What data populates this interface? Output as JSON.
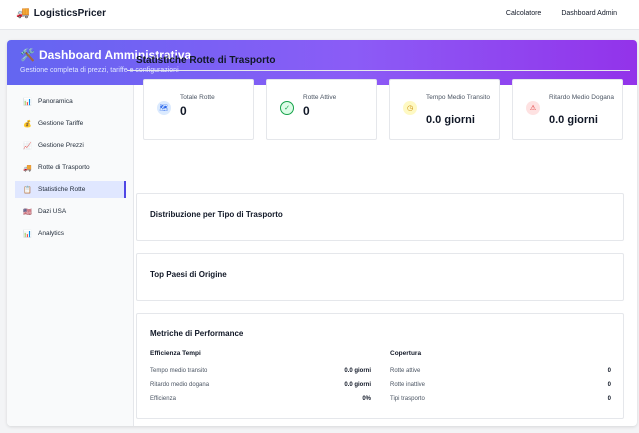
{
  "header": {
    "brand_icon": "🚚",
    "brand": "LogisticsPricer",
    "nav": [
      "Calcolatore",
      "Dashboard Admin"
    ]
  },
  "hero": {
    "icon": "🛠️",
    "title": "Dashboard Amministrativa",
    "subtitle": "Gestione completa di prezzi, tariffe e configurazioni",
    "gradient": [
      "#6366f1",
      "#9333ea"
    ]
  },
  "sidebar": {
    "items": [
      {
        "icon": "📊",
        "label": "Panoramica"
      },
      {
        "icon": "💰",
        "label": "Gestione Tariffe"
      },
      {
        "icon": "📈",
        "label": "Gestione Prezzi"
      },
      {
        "icon": "🚚",
        "label": "Rotte di Trasporto"
      },
      {
        "icon": "📋",
        "label": "Statistiche Rotte",
        "active": true
      },
      {
        "icon": "🇺🇸",
        "label": "Dazi USA"
      },
      {
        "icon": "📊",
        "label": "Analytics"
      }
    ]
  },
  "main": {
    "title": "Statistiche Rotte di Trasporto",
    "stats": [
      {
        "icon": "map-icon",
        "glyph": "🗺",
        "label": "Totale Rotte",
        "value": "0",
        "color": "#dbeafe"
      },
      {
        "icon": "check-circle-icon",
        "glyph": "✓",
        "label": "Rotte Attive",
        "value": "0",
        "color": "#dcfce7"
      },
      {
        "icon": "clock-icon",
        "glyph": "◷",
        "label": "Tempo Medio Transito",
        "value": "0.0 giorni",
        "color": "#fef9c3"
      },
      {
        "icon": "warning-icon",
        "glyph": "⚠",
        "label": "Ritardo Medio Dogana",
        "value": "0.0 giorni",
        "color": "#fee2e2"
      }
    ],
    "distribution_title": "Distribuzione per Tipo di Trasporto",
    "countries_title": "Top Paesi di Origine",
    "performance": {
      "title": "Metriche di Performance",
      "efficiency": {
        "heading": "Efficienza Tempi",
        "rows": [
          {
            "label": "Tempo medio transito",
            "value": "0.0 giorni"
          },
          {
            "label": "Ritardo medio dogana",
            "value": "0.0 giorni"
          },
          {
            "label": "Efficienza",
            "value": "0%"
          }
        ]
      },
      "coverage": {
        "heading": "Copertura",
        "rows": [
          {
            "label": "Rotte attive",
            "value": "0"
          },
          {
            "label": "Rotte inattive",
            "value": "0"
          },
          {
            "label": "Tipi trasporto",
            "value": "0"
          }
        ]
      }
    }
  }
}
